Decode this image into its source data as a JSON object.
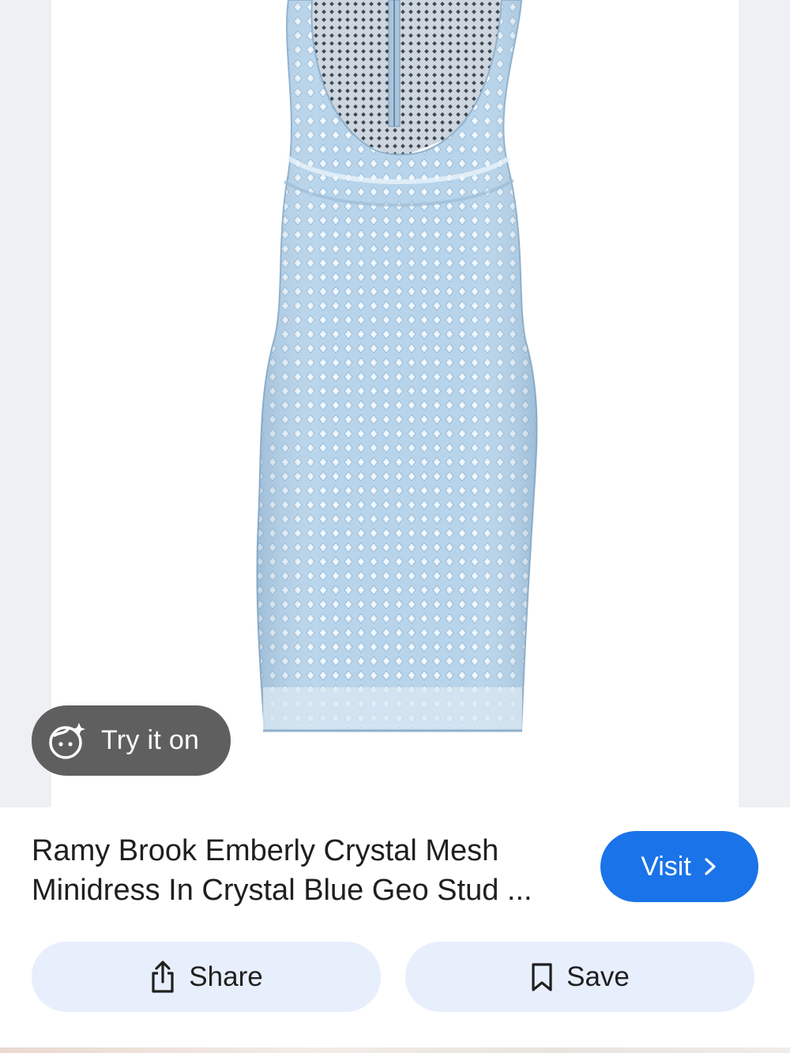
{
  "product": {
    "title": "Ramy Brook Emberly Crystal Mesh Minidress In Crystal Blue Geo Stud ...",
    "image_alt": "Crystal blue mesh minidress"
  },
  "try_on": {
    "label": "Try it on",
    "icon": "try-on-face-sparkle-icon"
  },
  "visit": {
    "label": "Visit",
    "icon": "chevron-right-icon",
    "color": "#1a73e8"
  },
  "actions": {
    "share_label": "Share",
    "share_icon": "share-icon",
    "save_label": "Save",
    "save_icon": "bookmark-icon"
  },
  "colors": {
    "dress": "#b9d6ec",
    "pill_bg": "#e8effc",
    "try_on_bg": "#5f5f5f"
  }
}
